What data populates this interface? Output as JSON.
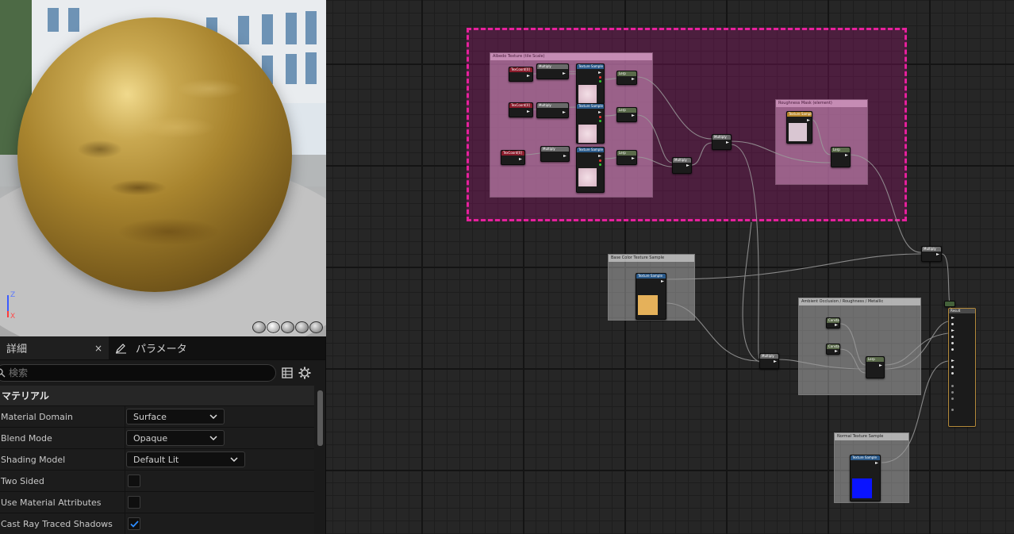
{
  "viewport": {
    "axis": {
      "z": "Z",
      "x": "X"
    },
    "tools": [
      "sphere-preview",
      "cylinder-preview",
      "plane-preview",
      "cube-preview",
      "mesh-preview"
    ]
  },
  "details_panel": {
    "tabs": [
      {
        "label": "詳細",
        "close": "×"
      },
      {
        "label": "パラメータ"
      }
    ],
    "search_placeholder": "検索",
    "category": "マテリアル",
    "properties": [
      {
        "label": "Material Domain",
        "value": "Surface",
        "type": "dropdown"
      },
      {
        "label": "Blend Mode",
        "value": "Opaque",
        "type": "dropdown"
      },
      {
        "label": "Shading Model",
        "value": "Default Lit",
        "type": "dropdown"
      },
      {
        "label": "Two Sided",
        "checked": false,
        "type": "checkbox"
      },
      {
        "label": "Use Material Attributes",
        "checked": false,
        "type": "checkbox"
      },
      {
        "label": "Cast Ray Traced Shadows",
        "checked": true,
        "type": "checkbox"
      }
    ]
  },
  "graph": {
    "comments": [
      {
        "id": "albedo-tex-group",
        "title": "Albedo Texture (tile Scale)"
      },
      {
        "id": "roughness-mask-group",
        "title": "Roughness Mask (element)"
      },
      {
        "id": "base-color-group",
        "title": "Base Color Texture Sample"
      },
      {
        "id": "aorm-group",
        "title": "Ambient Occlusion / Roughness / Metallic"
      },
      {
        "id": "normal-group",
        "title": "Normal Texture Sample"
      }
    ],
    "node_headers": {
      "texcoord": "TexCoord[0]",
      "multiply": "Multiply",
      "texture_sample": "Texture Sample",
      "lerp": "Lerp",
      "constant": "Constant",
      "result": "Result"
    },
    "colors": {
      "selection_outline": "#e6209c",
      "texcoord_header": "#8a1b2b",
      "texture_header": "#2b5a8a",
      "math_header": "#5a6a4a",
      "base_color_swatch": "#e5b15a",
      "normal_swatch": "#0a14ff",
      "wire": "#9a9a9a"
    }
  }
}
